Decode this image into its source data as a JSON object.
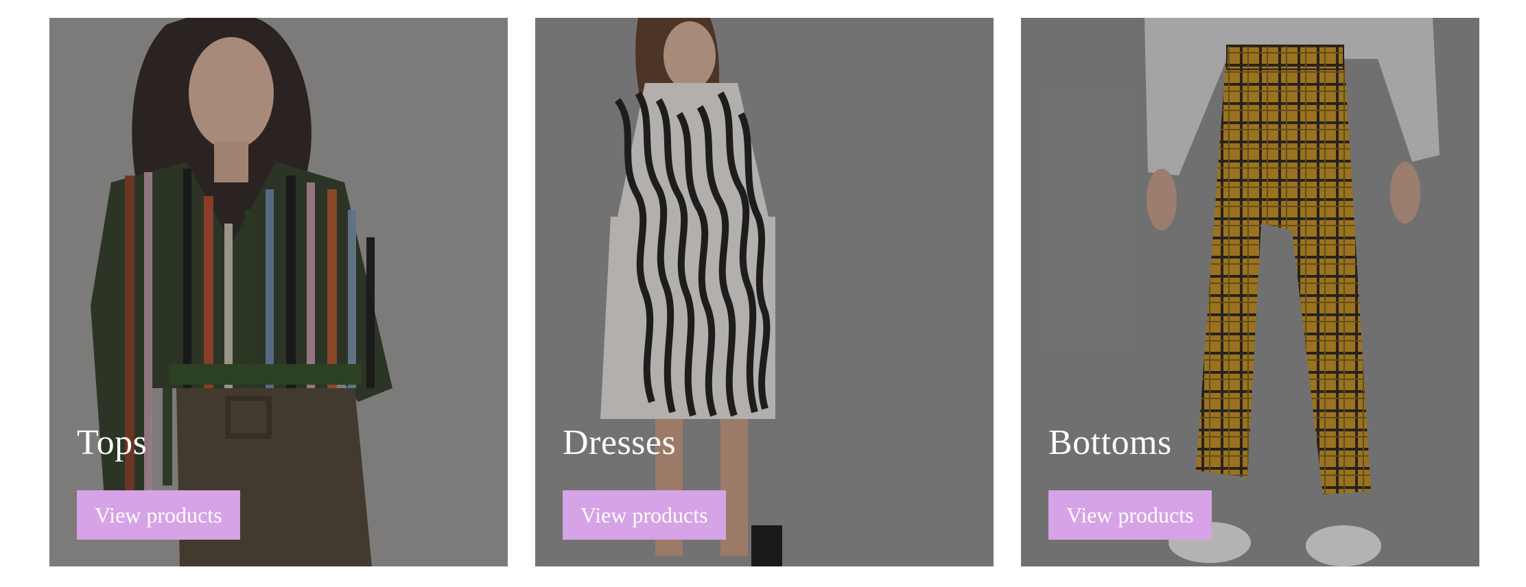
{
  "theme": {
    "accent": "#d6a3e6"
  },
  "categories": [
    {
      "title": "Tops",
      "button_label": "View products",
      "image": "woman-striped-top-photo"
    },
    {
      "title": "Dresses",
      "button_label": "View products",
      "image": "woman-zebra-dress-photo"
    },
    {
      "title": "Bottoms",
      "button_label": "View products",
      "image": "plaid-pants-photo"
    }
  ]
}
